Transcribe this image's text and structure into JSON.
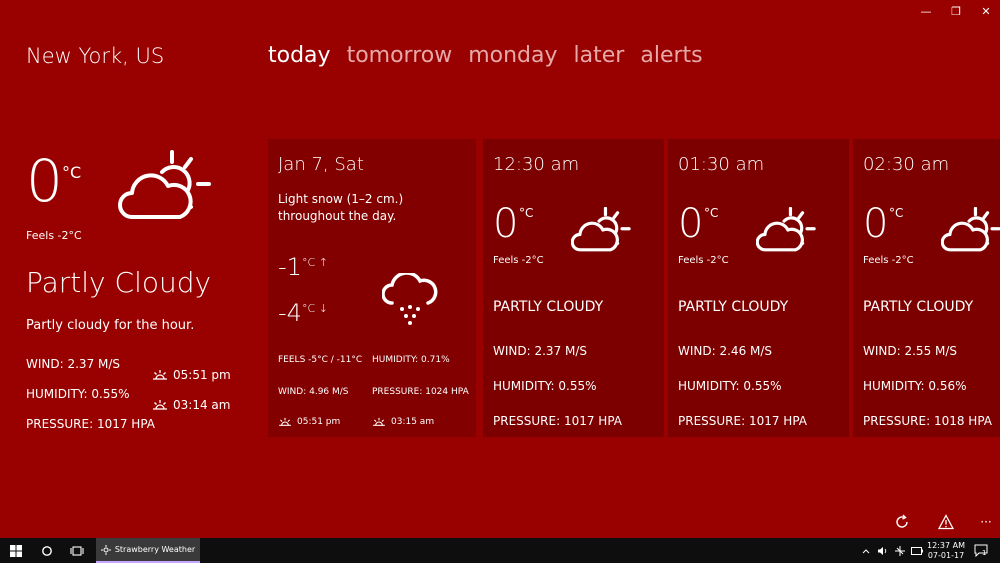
{
  "window": {
    "minimize": "—",
    "restore": "❐",
    "close": "✕"
  },
  "location": "New York, US",
  "tabs": [
    "today",
    "tomorrow",
    "monday",
    "later",
    "alerts"
  ],
  "current": {
    "temp": "0",
    "unit": "°C",
    "feels": "Feels -2°C",
    "condition": "Partly Cloudy",
    "description": "Partly cloudy for the hour.",
    "wind": "WIND: 2.37 M/S",
    "humidity": "HUMIDITY: 0.55%",
    "pressure": "PRESSURE: 1017 HPA",
    "sunrise": "05:51 pm",
    "sunset": "03:14 am"
  },
  "day_card": {
    "title": "Jan 7, Sat",
    "description": "Light snow (1–2 cm.) throughout the day.",
    "high": "-1",
    "high_unit": "°C ↑",
    "low": "-4",
    "low_unit": "°C ↓",
    "feels": "FEELS -5°C / -11°C",
    "humidity": "HUMIDITY: 0.71%",
    "wind": "WIND: 4.96 M/S",
    "pressure": "PRESSURE: 1024 HPA",
    "sunrise": "05:51 pm",
    "sunset": "03:15 am"
  },
  "hourly": [
    {
      "time": "12:30 am",
      "temp": "0",
      "unit": "°C",
      "feels": "Feels -2°C",
      "condition": "PARTLY CLOUDY",
      "wind": "WIND: 2.37 M/S",
      "humidity": "HUMIDITY: 0.55%",
      "pressure": "PRESSURE: 1017 HPA"
    },
    {
      "time": "01:30 am",
      "temp": "0",
      "unit": "°C",
      "feels": "Feels -2°C",
      "condition": "PARTLY CLOUDY",
      "wind": "WIND: 2.46 M/S",
      "humidity": "HUMIDITY: 0.55%",
      "pressure": "PRESSURE: 1017 HPA"
    },
    {
      "time": "02:30 am",
      "temp": "0",
      "unit": "°C",
      "feels": "Feels -2°C",
      "condition": "PARTLY CLOUDY",
      "wind": "WIND: 2.55 M/S",
      "humidity": "HUMIDITY: 0.56%",
      "pressure": "PRESSURE: 1018 HPA"
    }
  ],
  "appbar": {
    "more": "···"
  },
  "taskbar": {
    "app_name": "Strawberry Weather",
    "time": "12:37 AM",
    "date": "07-01-17",
    "notifications": "1"
  },
  "colors": {
    "background": "#990000",
    "card": "#7d0000",
    "tab_inactive": "#e7a8a8",
    "taskbar": "#0e0e0e"
  }
}
